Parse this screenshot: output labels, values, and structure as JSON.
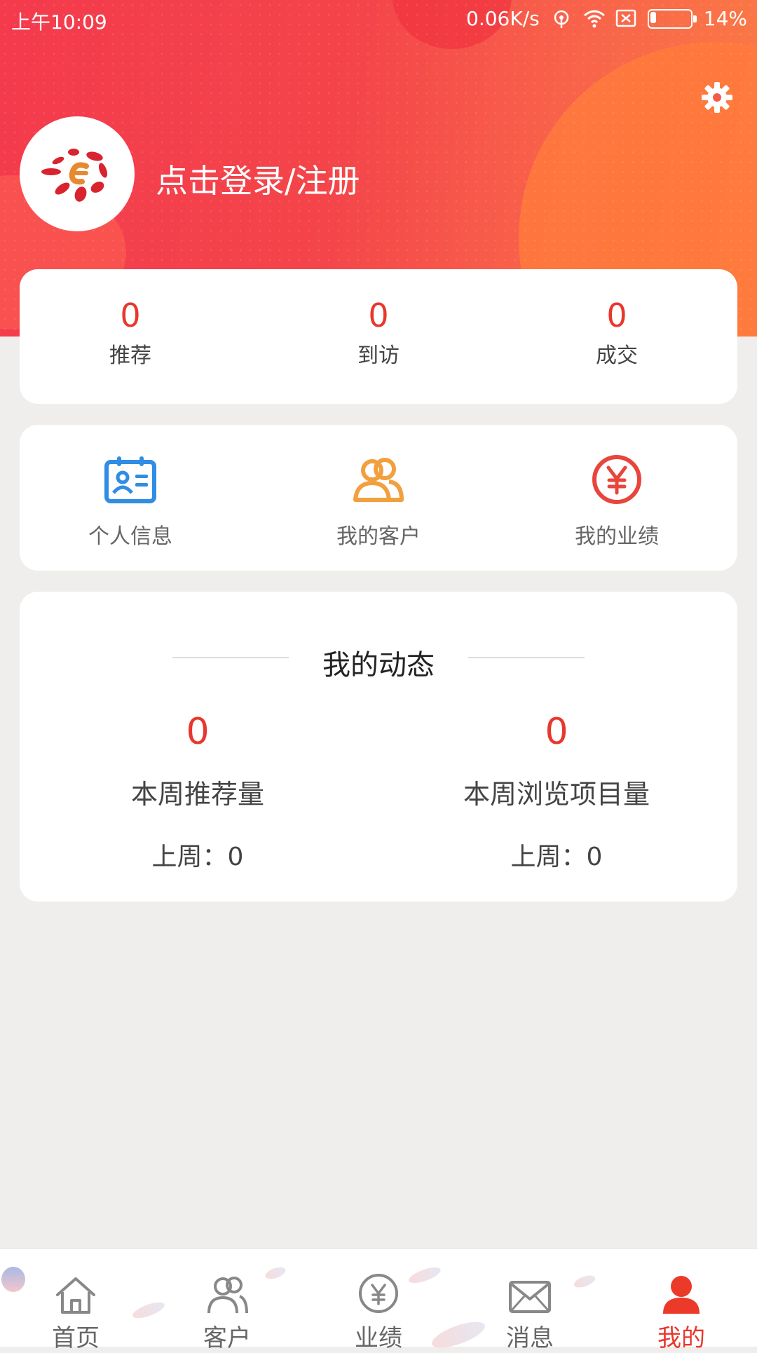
{
  "status_bar": {
    "time": "上午10:09",
    "network_speed": "0.06K/s",
    "battery": "14%",
    "battery_level": 0.14
  },
  "header": {
    "login_text": "点击登录/注册",
    "settings_icon": "gear-icon",
    "avatar_icon": "brand-logo"
  },
  "stats": [
    {
      "value": "0",
      "label": "推荐"
    },
    {
      "value": "0",
      "label": "到访"
    },
    {
      "value": "0",
      "label": "成交"
    }
  ],
  "menu": [
    {
      "label": "个人信息",
      "icon": "id-card-icon",
      "color": "#2f8de4"
    },
    {
      "label": "我的客户",
      "icon": "users-icon",
      "color": "#f2a03d"
    },
    {
      "label": "我的业绩",
      "icon": "yuan-icon",
      "color": "#e8453c"
    }
  ],
  "activity": {
    "title": "我的动态",
    "items": [
      {
        "value": "0",
        "label": "本周推荐量",
        "previous": "上周：0"
      },
      {
        "value": "0",
        "label": "本周浏览项目量",
        "previous": "上周：0"
      }
    ]
  },
  "bottom_nav": [
    {
      "label": "首页",
      "icon": "home-icon",
      "active": false
    },
    {
      "label": "客户",
      "icon": "customers-icon",
      "active": false
    },
    {
      "label": "业绩",
      "icon": "yuan-circle-icon",
      "active": false
    },
    {
      "label": "消息",
      "icon": "envelope-icon",
      "active": false
    },
    {
      "label": "我的",
      "icon": "person-icon",
      "active": true
    }
  ],
  "colors": {
    "accent": "#e8372d",
    "header_start": "#f43a4d",
    "header_end": "#fb7d45",
    "background": "#efeeec"
  }
}
